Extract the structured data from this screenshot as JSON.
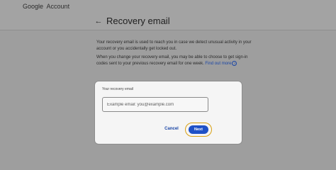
{
  "header": {
    "logo_google": "Google",
    "logo_account": "Account"
  },
  "page": {
    "back_icon": "arrow-left-icon",
    "title": "Recovery email"
  },
  "description": {
    "paragraph1": "Your recovery email is used to reach you in case we detect unusual activity in your account or you accidentally get locked out.",
    "paragraph2_text": "When you change your recovery email, you may be able to choose to get sign-in codes sent to your previous recovery email for one week. ",
    "paragraph2_link": "Find out more",
    "info_icon": "info-icon"
  },
  "form": {
    "label": "Your recovery email",
    "input_placeholder": "Example email: you@example.com",
    "input_value": "",
    "cancel_label": "Cancel",
    "next_label": "Next"
  },
  "colors": {
    "background": "#9e9e9e",
    "link": "#1a46a6",
    "primary_button": "#1f51c7",
    "focus_ring": "#d9a114"
  }
}
